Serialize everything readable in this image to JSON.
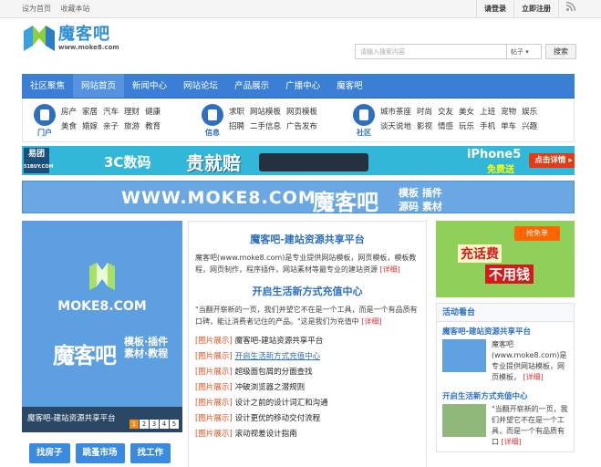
{
  "topbar": {
    "links_left": [
      "设为首页",
      "收藏本站"
    ],
    "links_right": [
      "请登录",
      "立即注册"
    ]
  },
  "logo": {
    "name": "魔客吧",
    "url": "www.moke8.com"
  },
  "search": {
    "placeholder": "请输入搜索内容",
    "scope": "帖子 ▾",
    "button": "搜索"
  },
  "nav": {
    "items": [
      "社区聚焦",
      "网站首页",
      "新闻中心",
      "网站论坛",
      "产品展示",
      "广播中心",
      "魔客吧"
    ]
  },
  "categories": [
    {
      "label": "门户",
      "rows": [
        [
          "房产",
          "家居",
          "汽车",
          "理财",
          "健康"
        ],
        [
          "美食",
          "婚嫁",
          "亲子",
          "旅游",
          "教育"
        ]
      ]
    },
    {
      "label": "信息",
      "rows": [
        [
          "求职",
          "网站模板",
          "网页模板"
        ],
        [
          "招聘",
          "二手信息",
          "广告发布"
        ]
      ]
    },
    {
      "label": "社区",
      "rows": [
        [
          "城市茶座",
          "时尚",
          "交友",
          "美女",
          "上班",
          "宠物",
          "娱乐"
        ],
        [
          "谈天说地",
          "影视",
          "情感",
          "玩乐",
          "手机",
          "单车",
          "兴趣"
        ]
      ]
    }
  ],
  "banner1": {
    "brand": "易团",
    "brand_sub": "51BUY.COM",
    "line1": "3C数码",
    "line2": "贵就赔",
    "phone": "iPhone5",
    "free": "免费送",
    "cta": "点击详情 ▸"
  },
  "banner2": {
    "url": "WWW.MOKE8.COM",
    "name": "魔客吧",
    "sub1": "模板 插件",
    "sub2": "源码 素材"
  },
  "slider": {
    "url": "MOKE8.COM",
    "name": "魔客吧",
    "sub": [
      "模板·插件",
      "素材·教程"
    ],
    "caption": "魔客吧-建站资源共享平台",
    "pages": [
      "1",
      "2",
      "3",
      "4",
      "5"
    ],
    "current_page": "1"
  },
  "tags": [
    "找房子",
    "跳蚤市场",
    "找工作"
  ],
  "headline1": {
    "title": "魔客吧-建站资源共享平台",
    "body": "魔客吧(www.moke8.com)是专业提供网站模板，网页模板，模板教程，网页制作，程序插件，网站素材等最专业的建站资源",
    "more": "[详细]"
  },
  "headline2": {
    "title": "开启生活新方式充值中心",
    "body": "\"当翻开崭新的一页，我们并望它不在是一个工具，而是一个有品质有口碑，能让消费者记住的产品。\"这是我们为充值中",
    "more": "[详细]"
  },
  "news": [
    {
      "tag": "[图片展示]",
      "title": "魔客吧-建站资源共享平台",
      "underline": false
    },
    {
      "tag": "[图片展示]",
      "title": "开启生活新方式充值中心",
      "underline": true
    },
    {
      "tag": "[图片展示]",
      "title": "超级面包屑的分面查找",
      "underline": false
    },
    {
      "tag": "[图片展示]",
      "title": "冲破浏览器之潜规则",
      "underline": false
    },
    {
      "tag": "[图片展示]",
      "title": "设计之前的设计词汇和沟通",
      "underline": false
    },
    {
      "tag": "[图片展示]",
      "title": "设计更优的移动交付流程",
      "underline": false
    },
    {
      "tag": "[图片展示]",
      "title": "滚动视差设计指南",
      "underline": false
    }
  ],
  "ad": {
    "badge": "抢免单",
    "line1": "充话费",
    "line2": "不用钱"
  },
  "sidebar": {
    "header": "活动看台",
    "items": [
      {
        "title": "魔客吧-建站资源共享平台",
        "desc": "魔客吧(www.moke8.com)是专业提供网站模板，网页模板，",
        "more": "[详细]"
      },
      {
        "title": "开启生活新方式充值中心",
        "desc": "\"当翻开崭新的一页，我们并望它不在是一个工具，而是一个有品质有口",
        "more": "[详细]"
      }
    ]
  },
  "colors": {
    "brand_blue": "#3a7fd5",
    "link_blue": "#2c6fc4",
    "tag_orange": "#e0501e",
    "more_red": "#e03030"
  }
}
